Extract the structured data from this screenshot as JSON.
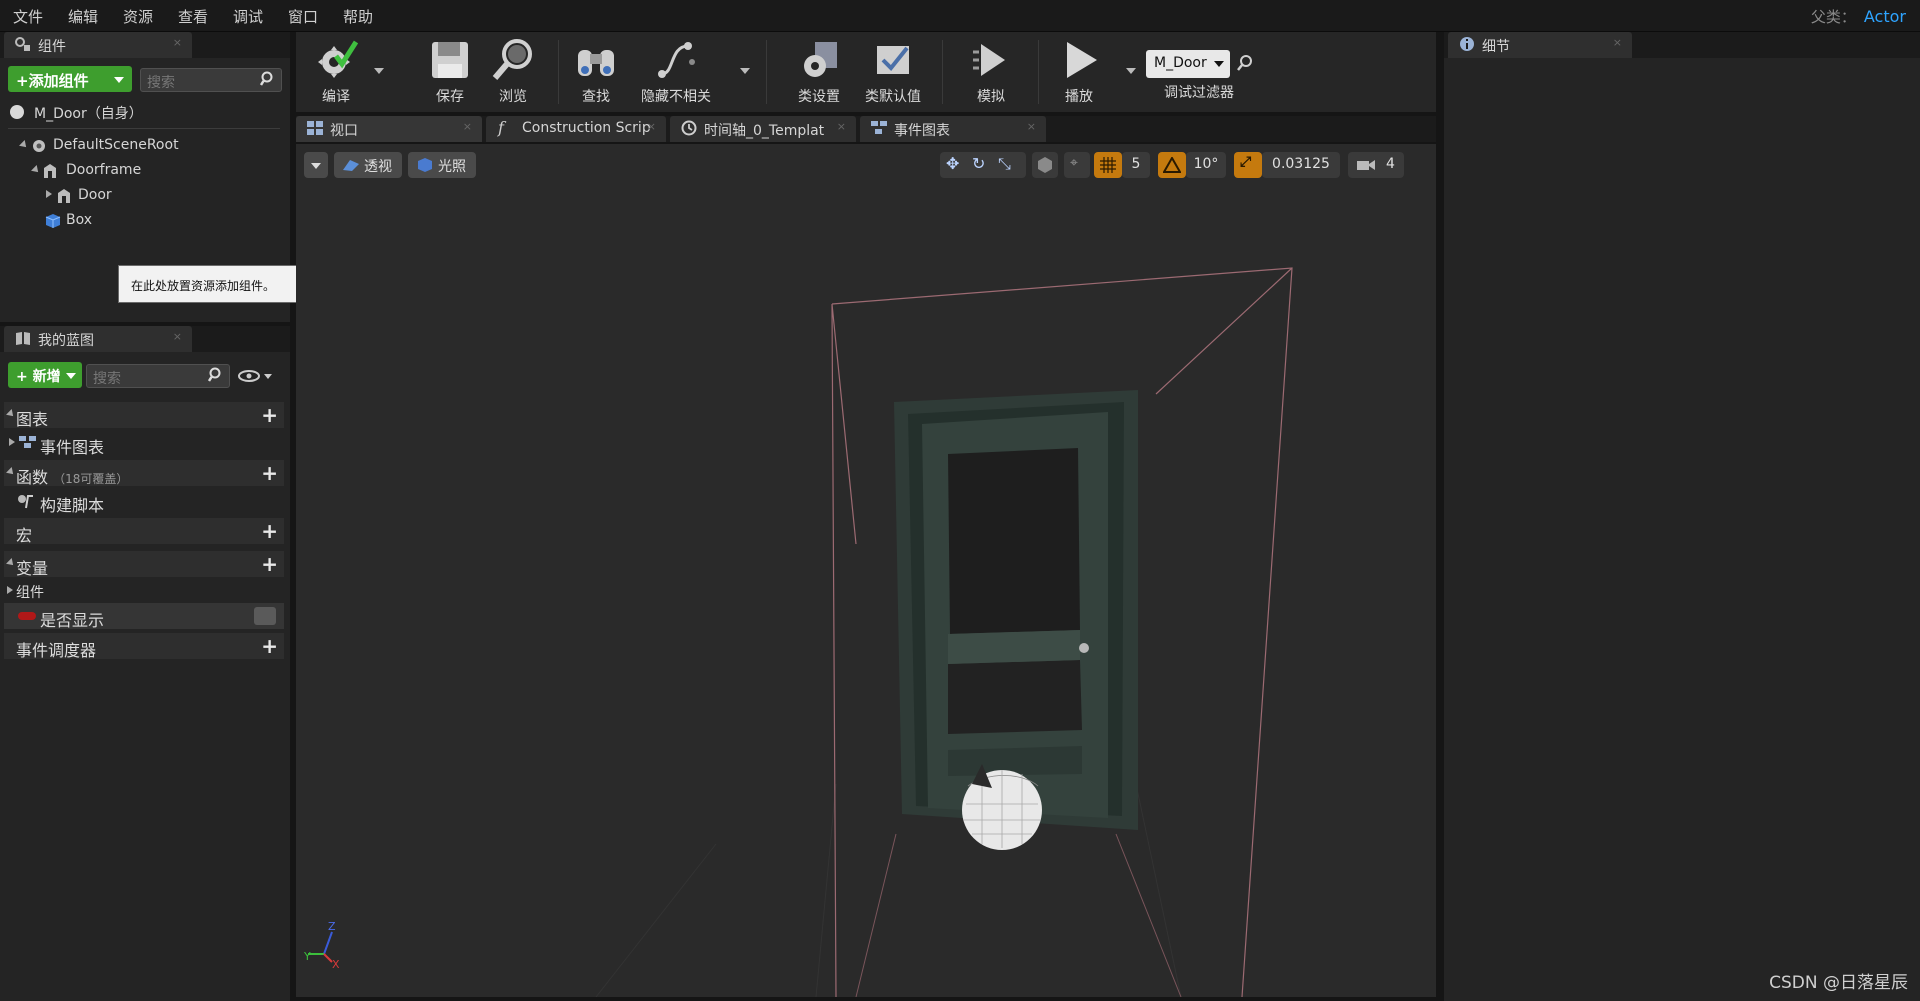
{
  "menubar": {
    "items": [
      "文件",
      "编辑",
      "资源",
      "查看",
      "调试",
      "窗口",
      "帮助"
    ],
    "parent_class_label": "父类：",
    "parent_class_value": "Actor"
  },
  "components_panel": {
    "tab_label": "组件",
    "add_component_label": "+添加组件",
    "search_placeholder": "搜索",
    "self_item": "M_Door（自身）",
    "tree": [
      "DefaultSceneRoot",
      "Doorframe",
      "Door",
      "Box"
    ],
    "tooltip": "在此处放置资源添加组件。"
  },
  "my_blueprint": {
    "tab_label": "我的蓝图",
    "new_label": "新增",
    "search_placeholder": "搜索",
    "sections": {
      "graphs": "图表",
      "event_graph": "事件图表",
      "functions": "函数",
      "functions_note": "（18可覆盖）",
      "construction_script": "构建脚本",
      "macros": "宏",
      "variables": "变量",
      "components": "组件",
      "is_visible": "是否显示",
      "event_dispatchers": "事件调度器"
    }
  },
  "toolbar": {
    "compile": "编译",
    "save": "保存",
    "browse": "浏览",
    "find": "查找",
    "hide_unrelated": "隐藏不相关",
    "class_settings": "类设置",
    "class_defaults": "类默认值",
    "simulate": "模拟",
    "play": "播放",
    "debug_object": "M_Door",
    "debug_filter": "调试过滤器"
  },
  "editor_tabs": {
    "viewport": "视口",
    "construction_script": "Construction Scrip",
    "timeline": "时间轴_0_Templat",
    "event_graph": "事件图表"
  },
  "viewport": {
    "perspective": "透视",
    "lit": "光照",
    "grid_snap": "5",
    "rotation_snap": "10°",
    "scale_snap": "0.03125",
    "camera_speed": "4",
    "axis_labels": [
      "Z",
      "Y",
      "X"
    ]
  },
  "details_panel": {
    "tab_label": "细节"
  },
  "watermark": "CSDN @\u0001\u0001\u0001日落星辰\u0001\u0001\u0001",
  "colors": {
    "accent_blue": "#2ea4ff",
    "green_button": "#3e9e2e",
    "snap_orange": "#c57a0e",
    "bounds_line": "#9c6a72"
  }
}
